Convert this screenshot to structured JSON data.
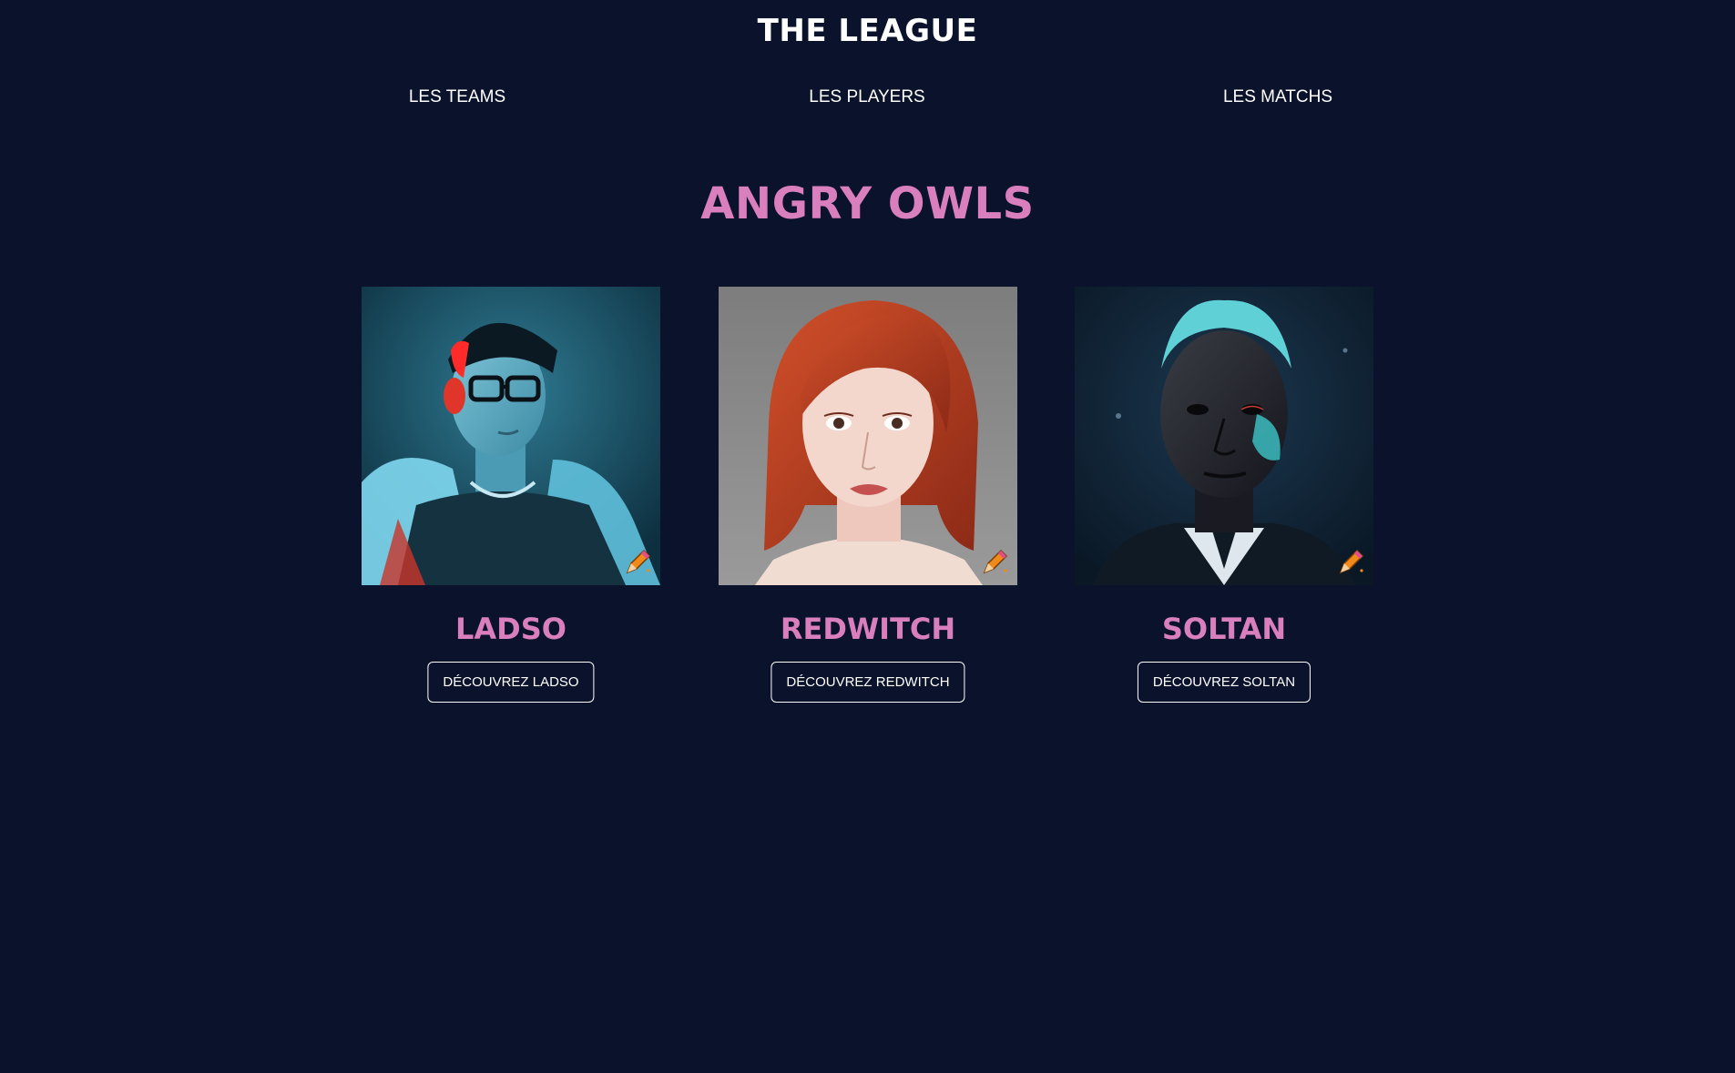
{
  "header": {
    "title": "THE LEAGUE"
  },
  "nav": {
    "items": [
      {
        "label": "LES TEAMS"
      },
      {
        "label": "LES PLAYERS"
      },
      {
        "label": "LES MATCHS"
      }
    ]
  },
  "team": {
    "name": "ANGRY OWLS"
  },
  "players": [
    {
      "name": "LADSO",
      "button_label": "DÉCOUVREZ LADSO",
      "image": "portrait-ladso",
      "badge_icon": "pencil-icon"
    },
    {
      "name": "REDWITCH",
      "button_label": "DÉCOUVREZ REDWITCH",
      "image": "portrait-redwitch",
      "badge_icon": "pencil-icon"
    },
    {
      "name": "SOLTAN",
      "button_label": "DÉCOUVREZ SOLTAN",
      "image": "portrait-soltan",
      "badge_icon": "pencil-icon"
    }
  ],
  "colors": {
    "background": "#0b122b",
    "accent_pink": "#d97fbe",
    "text": "#ffffff"
  }
}
